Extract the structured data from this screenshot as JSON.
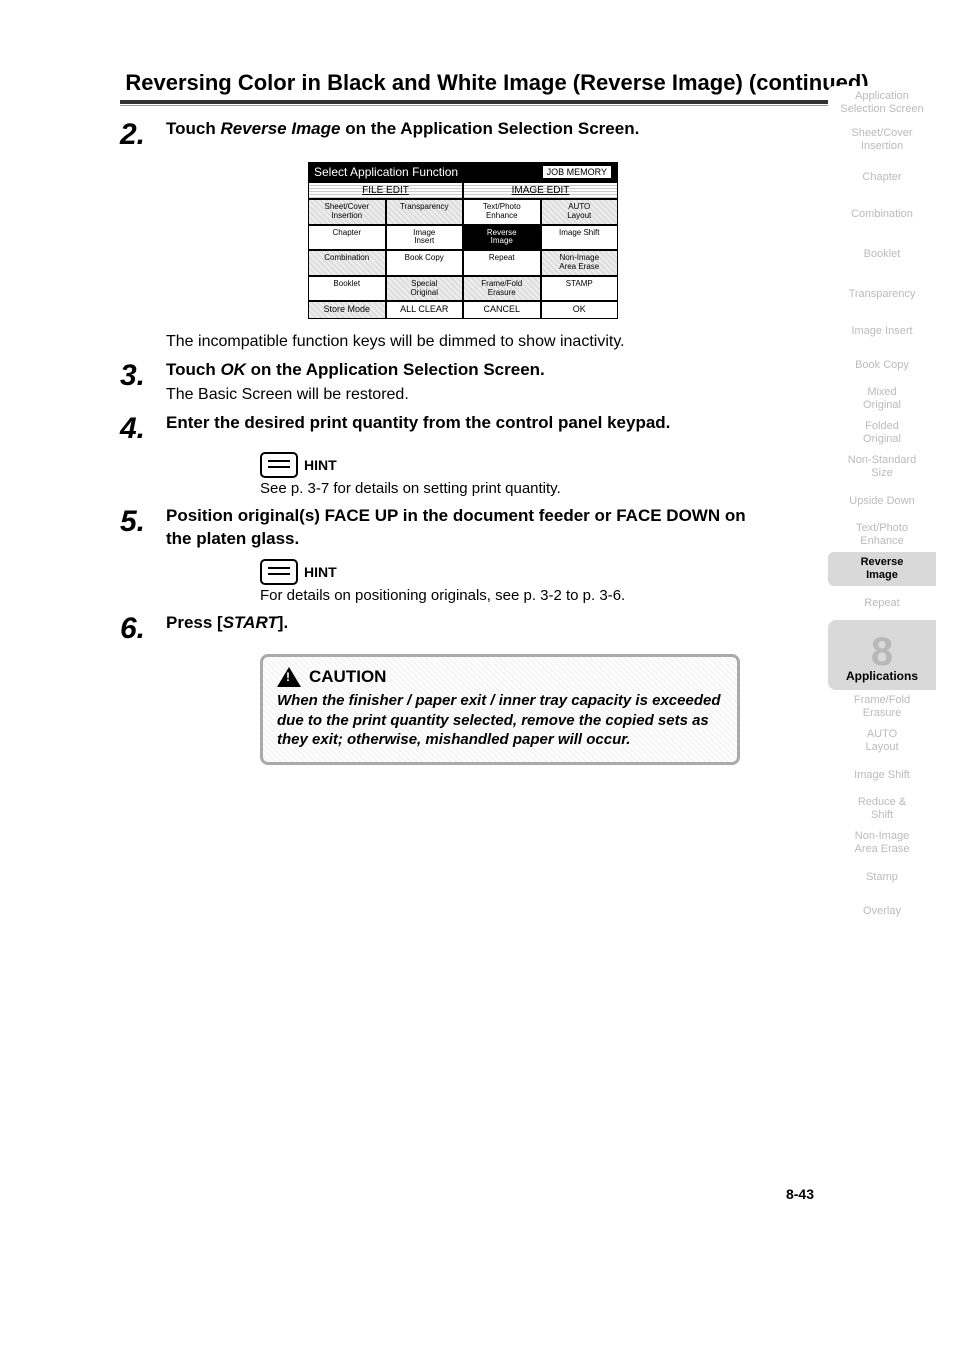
{
  "header": {
    "title": "Reversing Color in Black and White Image (Reverse Image) (continued)"
  },
  "steps": {
    "s2": {
      "num": "2.",
      "pre": "Touch ",
      "em": "Reverse Image",
      "post": " on the Application Selection Screen."
    },
    "s2_note": "The incompatible function keys will be dimmed to show inactivity.",
    "s3": {
      "num": "3.",
      "pre": "Touch ",
      "em": "OK",
      "post": " on the Application Selection Screen.",
      "sub": "The Basic Screen will be restored."
    },
    "s4": {
      "num": "4.",
      "text": "Enter the desired print quantity from the control panel keypad.",
      "hint_label": "HINT",
      "hint_text": "See p. 3-7 for details on setting print quantity."
    },
    "s5": {
      "num": "5.",
      "text": "Position original(s) FACE UP in the document feeder or FACE DOWN on the platen glass.",
      "hint_label": "HINT",
      "hint_text": "For details on positioning originals, see p. 3-2 to p. 3-6."
    },
    "s6": {
      "num": "6.",
      "pre": "Press [",
      "em": "START",
      "post": "]."
    }
  },
  "ui_mock": {
    "title": "Select Application Function",
    "job_memory": "JOB MEMORY",
    "sec_left": "FILE EDIT",
    "sec_right": "IMAGE EDIT",
    "row1": [
      "Sheet/Cover\nInsertion",
      "Transparency",
      "Text/Photo\nEnhance",
      "AUTO\nLayout"
    ],
    "row2": [
      "Chapter",
      "Image\nInsert",
      "Reverse\nImage",
      "Image Shift"
    ],
    "row3": [
      "Combination",
      "Book Copy",
      "Repeat",
      "Non-Image\nArea Erase"
    ],
    "row4": [
      "Booklet",
      "Special\nOriginal",
      "Frame/Fold\nErasure",
      "STAMP"
    ],
    "bottom": [
      "Store Mode",
      "ALL CLEAR",
      "CANCEL",
      "OK"
    ]
  },
  "caution": {
    "label": "CAUTION",
    "text": "When the finisher / paper exit / inner tray capacity is exceeded due to the print quantity selected, remove the copied sets as they exit; otherwise, mishandled paper will occur."
  },
  "sidebar": {
    "items": [
      "Application\nSelection Screen",
      "Sheet/Cover\nInsertion",
      "Chapter",
      "Combination",
      "Booklet",
      "Transparency",
      "Image Insert",
      "Book Copy",
      "Mixed\nOriginal",
      "Folded\nOriginal",
      "Non-Standard\nSize",
      "Upside Down",
      "Text/Photo\nEnhance",
      "Reverse\nImage",
      "Repeat"
    ],
    "chapter_num": "8",
    "chapter_label": "Applications",
    "items2": [
      "Frame/Fold\nErasure",
      "AUTO\nLayout",
      "Image Shift",
      "Reduce &\nShift",
      "Non-Image\nArea Erase",
      "Stamp",
      "Overlay"
    ]
  },
  "page_number": "8-43"
}
